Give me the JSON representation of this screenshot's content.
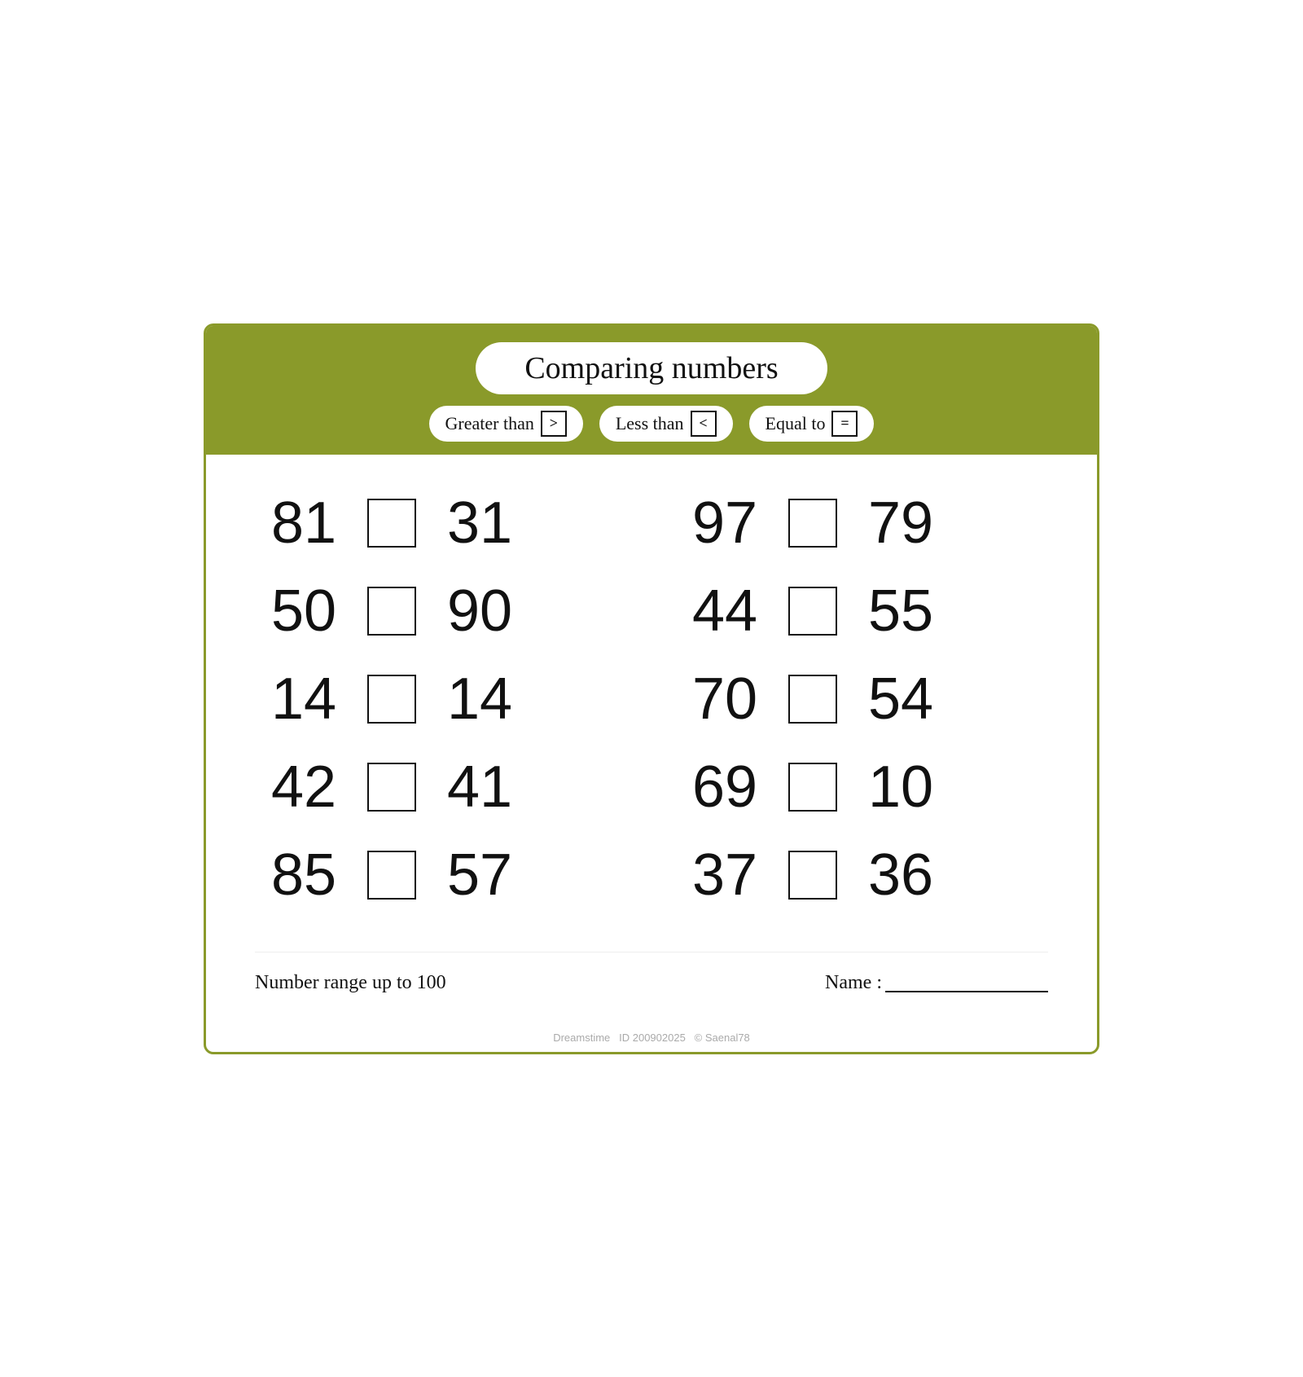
{
  "header": {
    "title": "Comparing numbers",
    "legend": [
      {
        "label": "Greater than",
        "symbol": ">"
      },
      {
        "label": "Less than",
        "symbol": "<"
      },
      {
        "label": "Equal to",
        "symbol": "="
      }
    ]
  },
  "problems": {
    "left": [
      {
        "left": "81",
        "right": "31"
      },
      {
        "left": "50",
        "right": "90"
      },
      {
        "left": "14",
        "right": "14"
      },
      {
        "left": "42",
        "right": "41"
      },
      {
        "left": "85",
        "right": "57"
      }
    ],
    "right": [
      {
        "left": "97",
        "right": "79"
      },
      {
        "left": "44",
        "right": "55"
      },
      {
        "left": "70",
        "right": "54"
      },
      {
        "left": "69",
        "right": "10"
      },
      {
        "left": "37",
        "right": "36"
      }
    ]
  },
  "footer": {
    "range_text": "Number range up to 100",
    "name_label": "Name :"
  },
  "watermark": {
    "id": "ID 200902025",
    "author": "© Saenal78",
    "site": "Dreamstime"
  }
}
